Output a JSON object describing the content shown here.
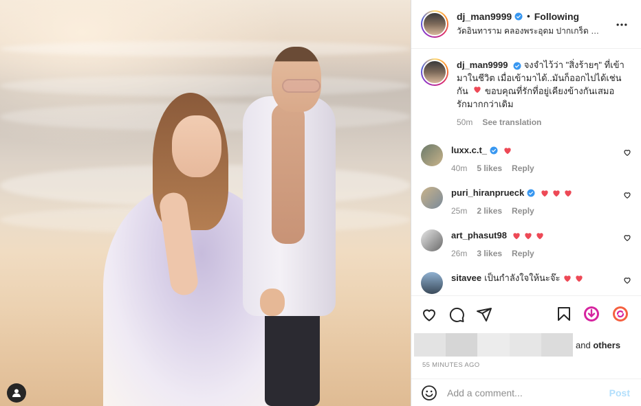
{
  "post": {
    "username": "dj_man9999",
    "follow_status": "Following",
    "location": "วัดอินทาราม คลองพระอุดม ปากเกร็ด นนทบุรี"
  },
  "caption": {
    "username": "dj_man9999",
    "text_1": "จงจำไว้ว่า \"สิ่งร้ายๆ\" ที่เข้ามาในชีวิต เมื่อเข้ามาได้..มันก็ออกไปได้เช่นกัน",
    "text_2": "ขอบคุณที่รักที่อยู่เคียงข้างกันเสมอ รักมากกว่าเดิม",
    "time": "50m",
    "see_translation": "See translation"
  },
  "comments": [
    {
      "username": "luxx.c.t_",
      "text": "",
      "hearts": 1,
      "verified": true,
      "time": "40m",
      "likes": "5 likes",
      "reply": "Reply"
    },
    {
      "username": "puri_hiranprueck",
      "text": "",
      "hearts": 3,
      "verified": true,
      "time": "25m",
      "likes": "2 likes",
      "reply": "Reply"
    },
    {
      "username": "art_phasut98",
      "text": "",
      "hearts": 3,
      "verified": false,
      "time": "26m",
      "likes": "3 likes",
      "reply": "Reply"
    },
    {
      "username": "sitavee",
      "text": "เป็นกำลังใจให้นะจ๊ะ",
      "hearts": 2,
      "verified": false,
      "time": "",
      "likes": "",
      "reply": ""
    }
  ],
  "likes": {
    "and": "and",
    "others": "others"
  },
  "timestamp": "55 MINUTES AGO",
  "add_comment": {
    "placeholder": "Add a comment...",
    "post_label": "Post"
  },
  "colors": {
    "verified": "#3897f0",
    "heart": "#ed4956",
    "post_disabled": "#b2dffc",
    "muted": "#8e8e8e"
  },
  "icons": [
    "heart-icon",
    "comment-icon",
    "share-icon",
    "bookmark-icon",
    "download-icon",
    "repost-icon",
    "more-icon",
    "emoji-icon",
    "user-tag-icon",
    "verified-icon"
  ]
}
